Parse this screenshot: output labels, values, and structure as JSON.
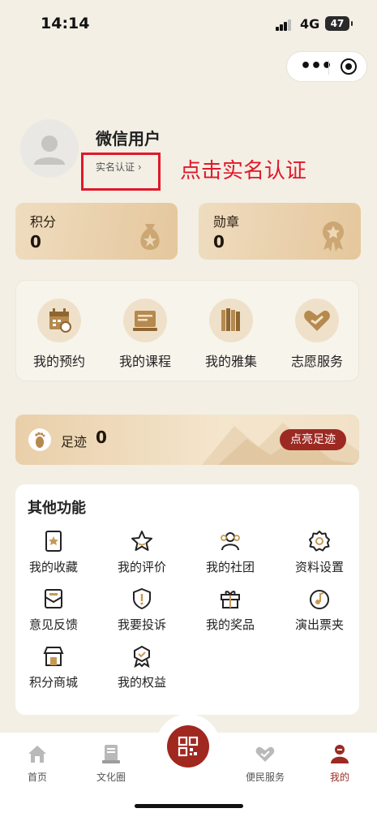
{
  "status_bar": {
    "time": "14:14",
    "network": "4G",
    "battery": "47"
  },
  "profile": {
    "username": "微信用户",
    "verify_link": "实名认证",
    "annotation": "点击实名认证"
  },
  "stats": [
    {
      "label": "积分",
      "value": "0",
      "icon": "money-bag-icon"
    },
    {
      "label": "勋章",
      "value": "0",
      "icon": "medal-icon"
    }
  ],
  "quick_actions": [
    {
      "label": "我的预约",
      "icon": "calendar-icon"
    },
    {
      "label": "我的课程",
      "icon": "course-icon"
    },
    {
      "label": "我的雅集",
      "icon": "books-icon"
    },
    {
      "label": "志愿服务",
      "icon": "handshake-heart-icon"
    }
  ],
  "footprint": {
    "label": "足迹",
    "count": "0",
    "button": "点亮足迹"
  },
  "other_functions": {
    "title": "其他功能",
    "items": [
      {
        "label": "我的收藏",
        "icon": "bookmark-star-icon"
      },
      {
        "label": "我的评价",
        "icon": "star-icon"
      },
      {
        "label": "我的社团",
        "icon": "group-icon"
      },
      {
        "label": "资料设置",
        "icon": "gear-icon"
      },
      {
        "label": "意见反馈",
        "icon": "feedback-icon"
      },
      {
        "label": "我要投诉",
        "icon": "complaint-shield-icon"
      },
      {
        "label": "我的奖品",
        "icon": "gift-icon"
      },
      {
        "label": "演出票夹",
        "icon": "music-note-icon"
      },
      {
        "label": "积分商城",
        "icon": "store-icon"
      },
      {
        "label": "我的权益",
        "icon": "badge-icon"
      }
    ]
  },
  "tabbar": [
    {
      "label": "首页",
      "icon": "home-icon",
      "active": false
    },
    {
      "label": "文化圈",
      "icon": "culture-circle-icon",
      "active": false
    },
    {
      "label": "便民服务",
      "icon": "service-icon",
      "active": false
    },
    {
      "label": "我的",
      "icon": "user-icon",
      "active": true
    }
  ],
  "colors": {
    "accent": "#9c2a23",
    "annotation": "#e0182a",
    "background": "#f3efe5"
  }
}
